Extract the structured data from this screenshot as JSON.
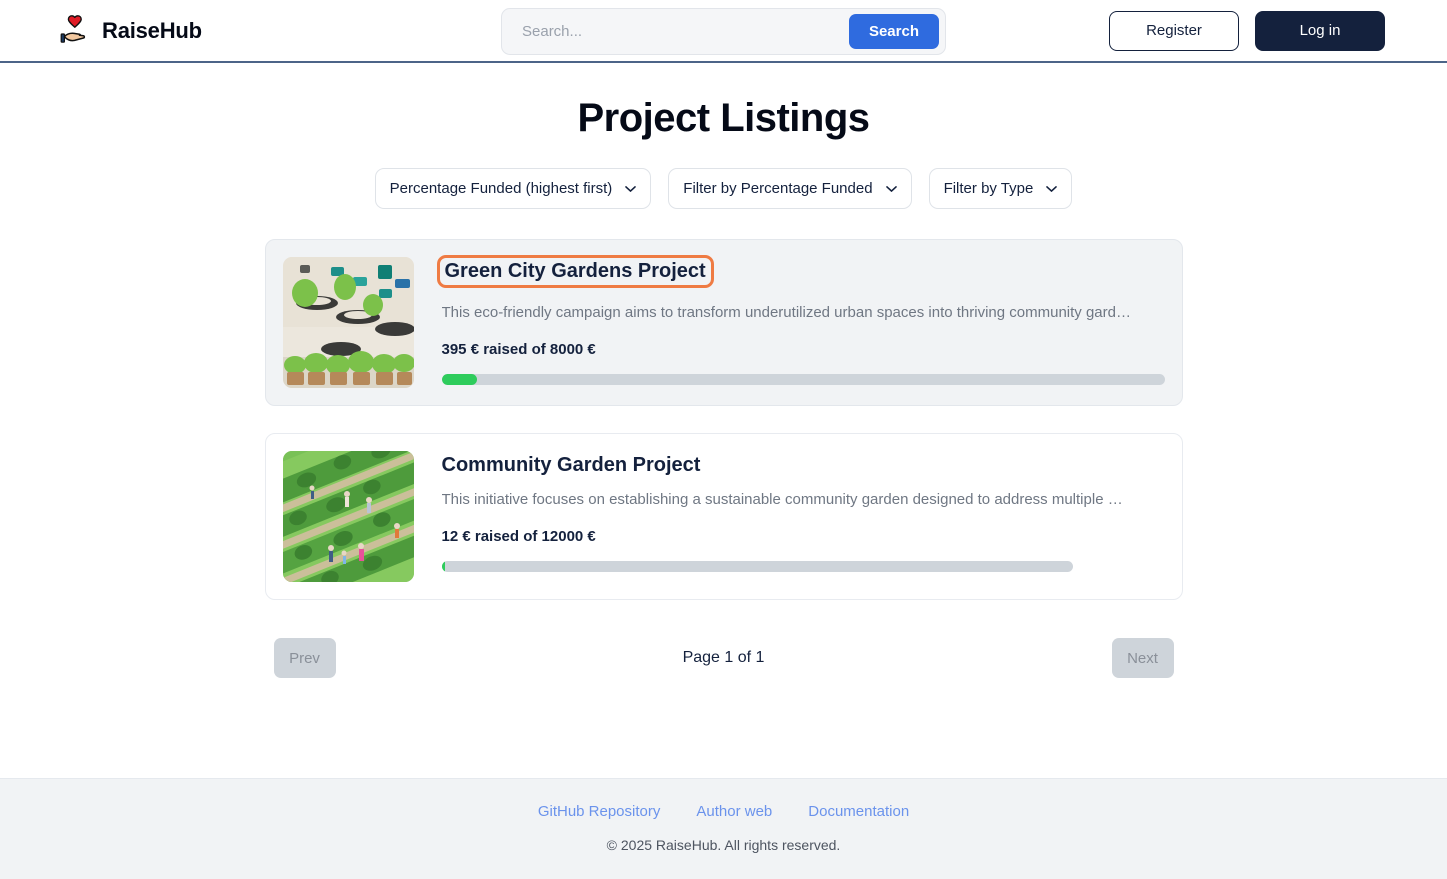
{
  "header": {
    "brand_name": "RaiseHub",
    "logo_icon": "hand-heart-icon",
    "search": {
      "placeholder": "Search...",
      "value": "",
      "button_label": "Search"
    },
    "register_label": "Register",
    "login_label": "Log in"
  },
  "main": {
    "page_title": "Project Listings",
    "filters": [
      {
        "name": "sort-select",
        "value": "Percentage Funded (highest first)"
      },
      {
        "name": "percentage-filter-select",
        "value": "Filter by Percentage Funded"
      },
      {
        "name": "type-filter-select",
        "value": "Filter by Type"
      }
    ],
    "projects": [
      {
        "title": "Green City Gardens Project",
        "description": "This eco-friendly campaign aims to transform underutilized urban spaces into thriving community gard…",
        "raised_text": "395 € raised of 8000 €",
        "raised": 395,
        "goal": 8000,
        "progress_percent": 4.9,
        "image_alt": "vertical-tire-garden-photo",
        "highlighted": true,
        "hovered": true
      },
      {
        "title": "Community Garden Project",
        "description": "This initiative focuses on establishing a sustainable community garden designed to address multiple …",
        "raised_text": "12 € raised of 12000 €",
        "raised": 12,
        "goal": 12000,
        "progress_percent": 0.6,
        "image_alt": "aerial-community-garden-photo",
        "highlighted": false,
        "hovered": false
      }
    ],
    "pagination": {
      "prev_label": "Prev",
      "next_label": "Next",
      "page_info": "Page 1 of 1"
    }
  },
  "footer": {
    "links": [
      {
        "label": "GitHub Repository"
      },
      {
        "label": "Author web"
      },
      {
        "label": "Documentation"
      }
    ],
    "copyright": "© 2025 RaiseHub. All rights reserved."
  },
  "colors": {
    "accent_blue": "#2f6bdf",
    "dark_navy": "#14213d",
    "progress_green": "#2ecc5c",
    "progress_track": "#ced4da",
    "highlight_orange": "#ef7b43",
    "footer_link_blue": "#6b93ec"
  }
}
